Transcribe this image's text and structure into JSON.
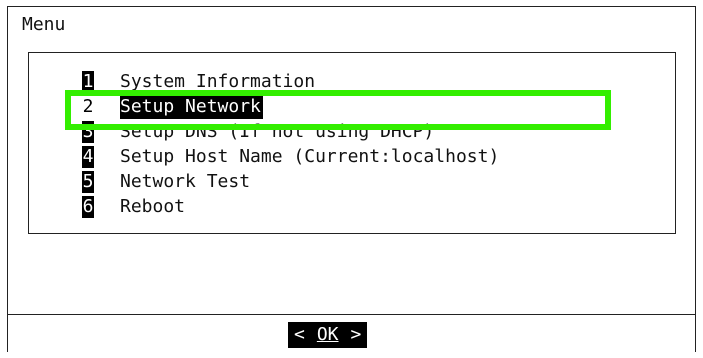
{
  "dialog": {
    "title": "Menu"
  },
  "menu": {
    "items": [
      {
        "number": "1",
        "label": "System Information"
      },
      {
        "number": "2",
        "label": "Setup Network",
        "selected": true
      },
      {
        "number": "3",
        "label": "Setup DNS (If not using DHCP)"
      },
      {
        "number": "4",
        "label": "Setup Host Name (Current:localhost)"
      },
      {
        "number": "5",
        "label": "Network Test"
      },
      {
        "number": "6",
        "label": "Reboot"
      }
    ]
  },
  "buttons": {
    "ok_left": "<",
    "ok_label": "OK",
    "ok_right": ">"
  },
  "colors": {
    "highlight": "#33ee00",
    "selection_bg": "#000000",
    "text": "#111111"
  }
}
